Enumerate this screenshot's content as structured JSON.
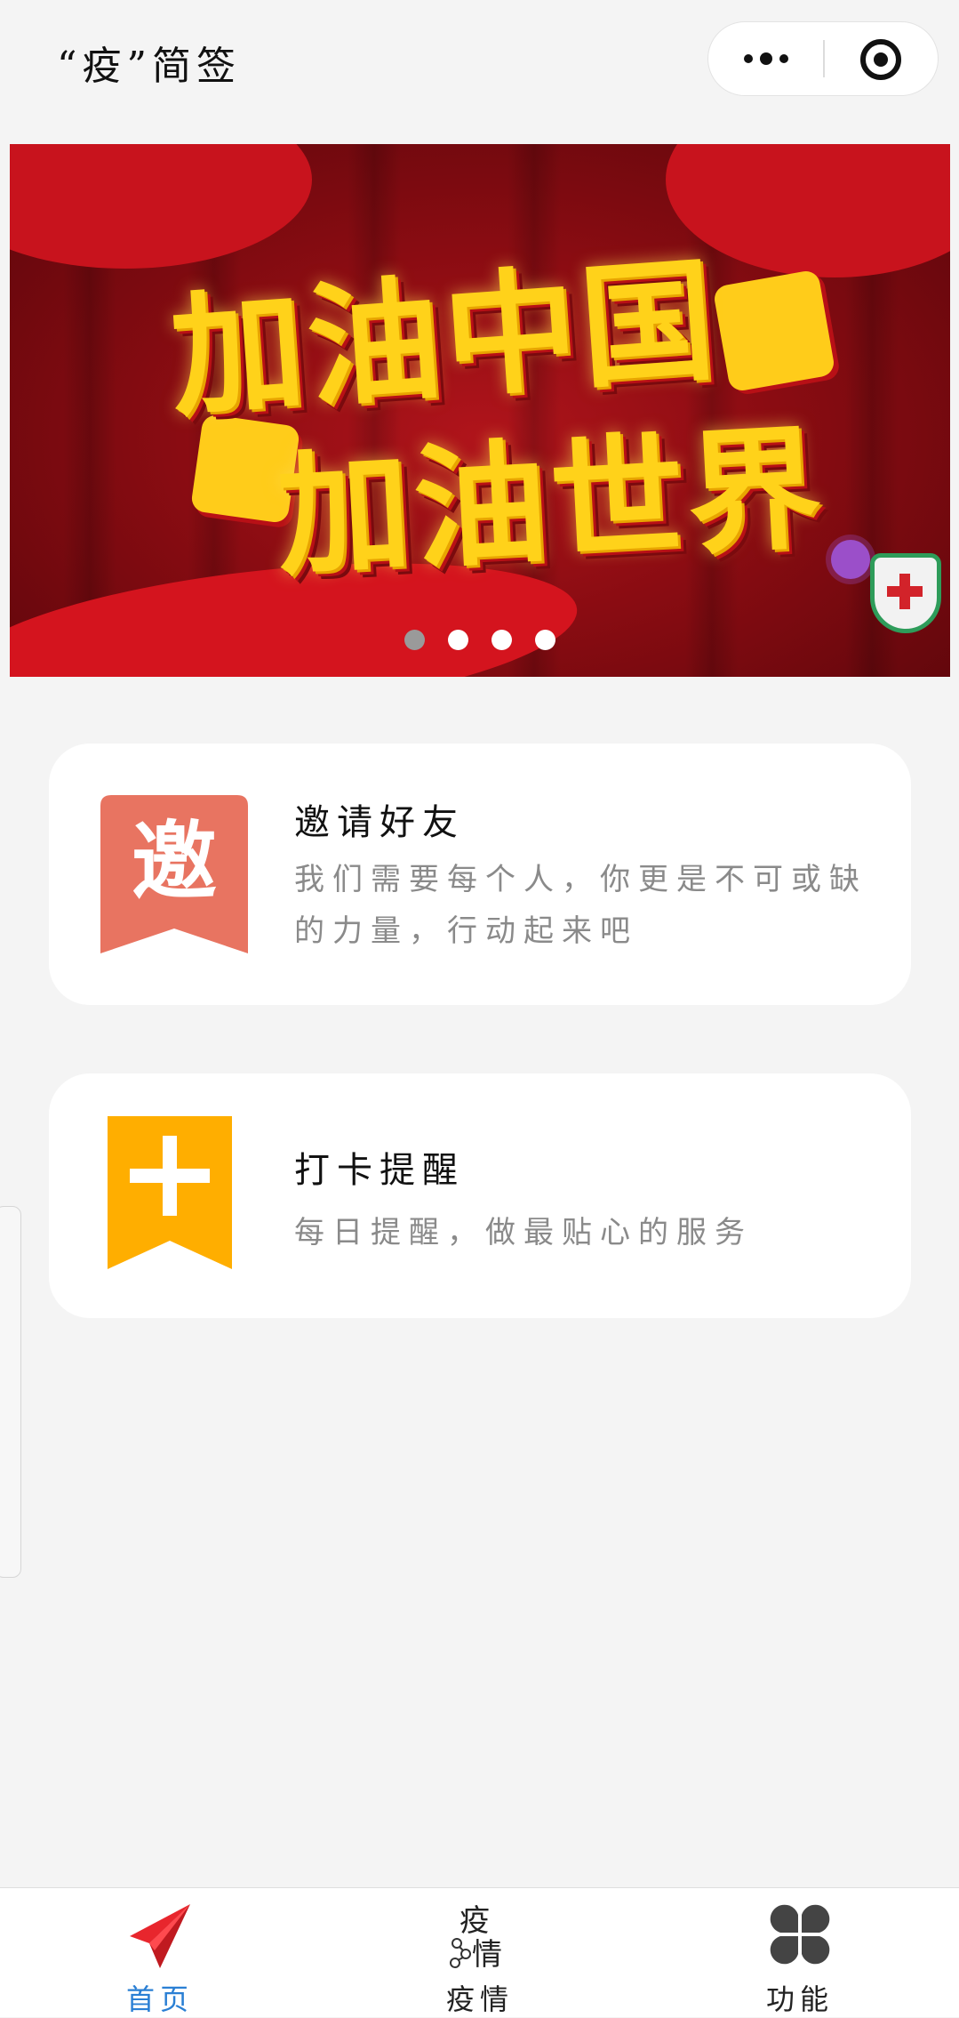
{
  "header": {
    "title": "“疫”简签"
  },
  "banner": {
    "slogan_line1": "加油中国",
    "slogan_line2": "加油世界",
    "slide_count": 4,
    "active_slide": 1
  },
  "cards": [
    {
      "badge_char": "邀",
      "badge_color": "#e87461",
      "title": "邀请好友",
      "description": "我们需要每个人，你更是不可或缺的力量，行动起来吧"
    },
    {
      "badge_char": "+",
      "badge_color": "#ffae00",
      "title": "打卡提醒",
      "description": "每日提醒，做最贴心的服务"
    }
  ],
  "tabbar": {
    "active_color": "#2a7fd4",
    "items": [
      {
        "label": "首页",
        "icon": "paper-plane-icon",
        "active": true
      },
      {
        "label": "疫情",
        "icon": "epidemic-icon",
        "icon_text_top": "疫",
        "icon_text_bottom": "情",
        "active": false
      },
      {
        "label": "功能",
        "icon": "clover-grid-icon",
        "active": false
      }
    ]
  }
}
